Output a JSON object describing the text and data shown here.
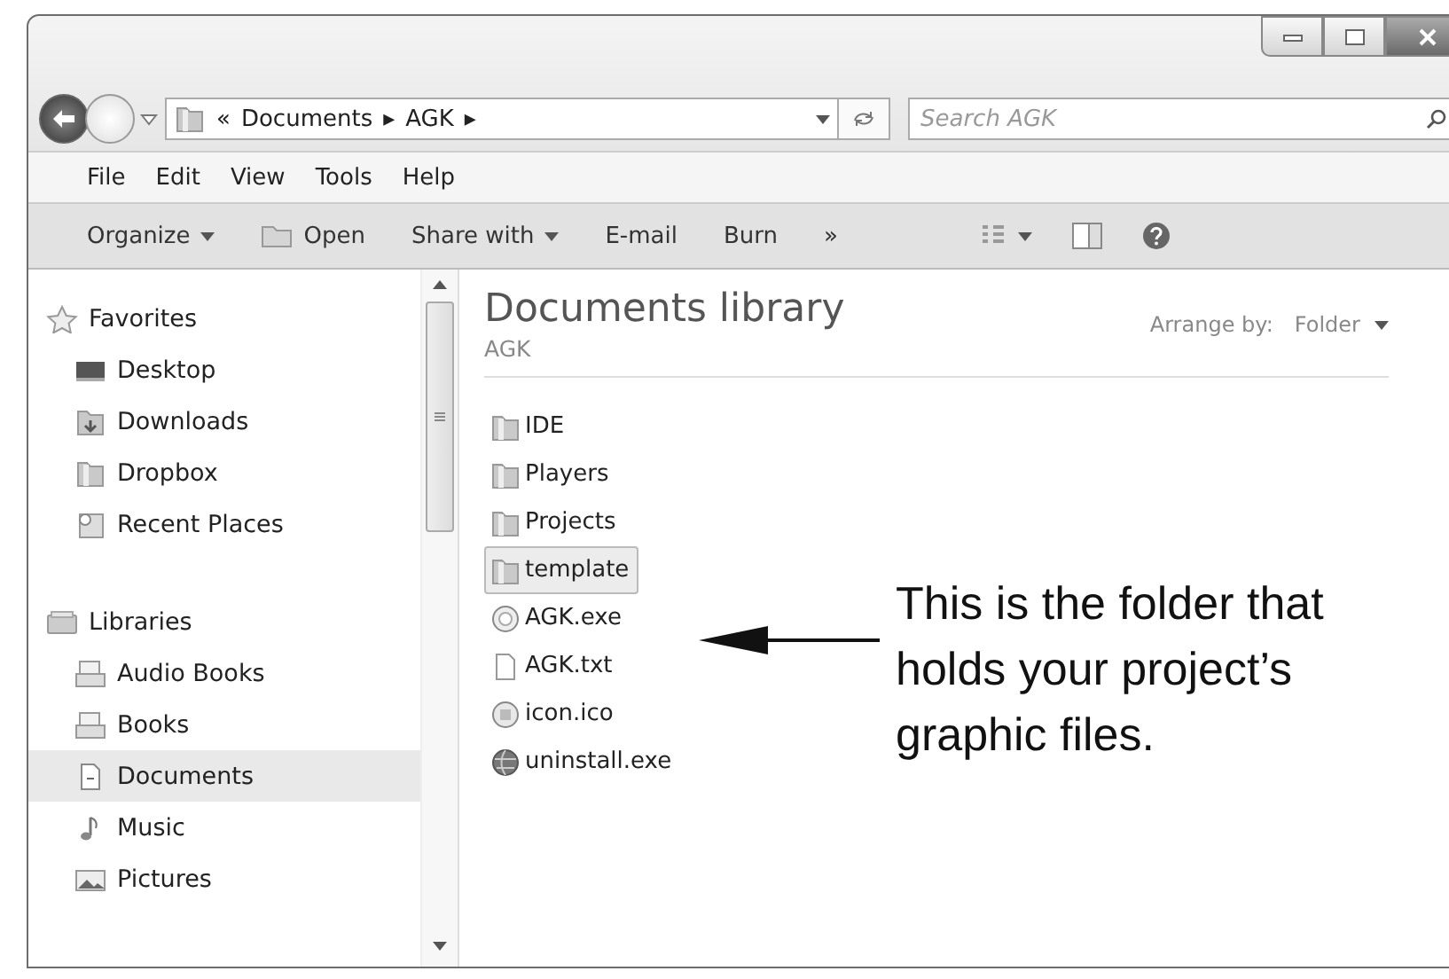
{
  "address": {
    "crumbs": [
      "«",
      "Documents",
      "▸",
      "AGK",
      "▸"
    ]
  },
  "search": {
    "placeholder": "Search AGK"
  },
  "menu": [
    "File",
    "Edit",
    "View",
    "Tools",
    "Help"
  ],
  "commands": [
    {
      "label": "Organize",
      "kind": "dropdown"
    },
    {
      "label": "Open",
      "kind": "icon"
    },
    {
      "label": "Share with",
      "kind": "dropdown"
    },
    {
      "label": "E-mail",
      "kind": "plain"
    },
    {
      "label": "Burn",
      "kind": "plain"
    },
    {
      "label": "»",
      "kind": "plain"
    }
  ],
  "sidebar": {
    "groups": [
      {
        "label": "Favorites",
        "kind": "favorites",
        "children": [
          {
            "label": "Desktop",
            "kind": "desktop",
            "selected": false
          },
          {
            "label": "Downloads",
            "kind": "downloads",
            "selected": false
          },
          {
            "label": "Dropbox",
            "kind": "folder",
            "selected": false
          },
          {
            "label": "Recent Places",
            "kind": "recent",
            "selected": false
          }
        ]
      },
      {
        "label": "Libraries",
        "kind": "library",
        "children": [
          {
            "label": "Audio Books",
            "kind": "library_item",
            "selected": false
          },
          {
            "label": "Books",
            "kind": "library_item",
            "selected": false
          },
          {
            "label": "Documents",
            "kind": "document",
            "selected": true
          },
          {
            "label": "Music",
            "kind": "music",
            "selected": false
          },
          {
            "label": "Pictures",
            "kind": "pictures",
            "selected": false
          }
        ]
      }
    ]
  },
  "content": {
    "title": "Documents library",
    "subtitle": "AGK",
    "arrange_label": "Arrange by:",
    "arrange_value": "Folder"
  },
  "files": [
    {
      "name": "IDE",
      "kind": "folder",
      "selected": false
    },
    {
      "name": "Players",
      "kind": "folder",
      "selected": false
    },
    {
      "name": "Projects",
      "kind": "folder",
      "selected": false
    },
    {
      "name": "template",
      "kind": "folder",
      "selected": true
    },
    {
      "name": "AGK.exe",
      "kind": "application",
      "selected": false
    },
    {
      "name": "AGK.txt",
      "kind": "text",
      "selected": false
    },
    {
      "name": "icon.ico",
      "kind": "icon_file",
      "selected": false
    },
    {
      "name": "uninstall.exe",
      "kind": "installer",
      "selected": false
    }
  ],
  "annotation": {
    "text": "This is the folder that\nholds your project’s\ngraphic files."
  }
}
